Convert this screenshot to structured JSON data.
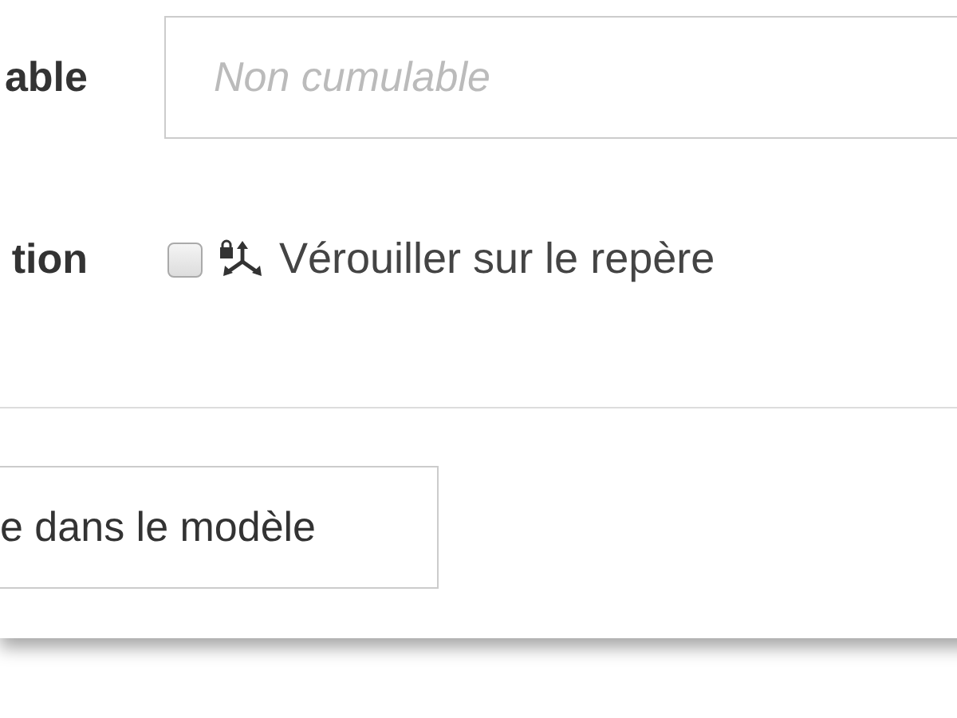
{
  "fields": [
    {
      "kind": "text",
      "label": "able",
      "placeholder": "Non cumulable"
    },
    {
      "kind": "checkbox",
      "label": "tion",
      "checked": false,
      "option": "Vérouiller sur le repère"
    }
  ],
  "button": {
    "label": "e dans le modèle"
  }
}
